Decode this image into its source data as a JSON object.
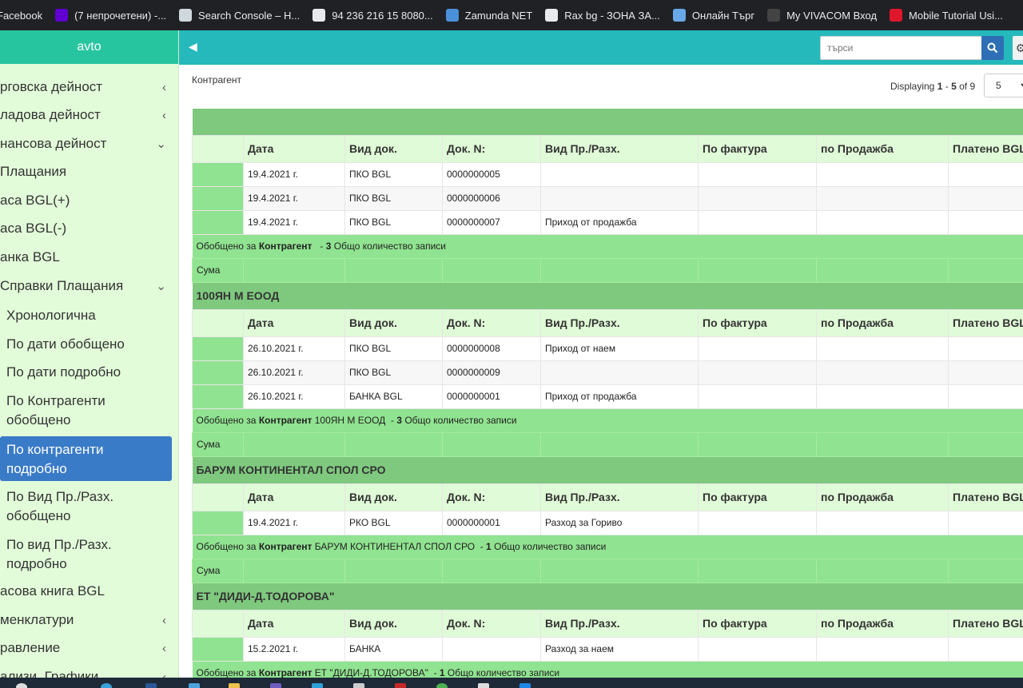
{
  "bookmarks": [
    {
      "label": "Facebook",
      "icon": "facebook-icon",
      "color": "#1877f2"
    },
    {
      "label": "(7 непрочетени) -...",
      "icon": "yahoo-mail-icon",
      "color": "#6001d2"
    },
    {
      "label": "Search Console – H...",
      "icon": "store-icon",
      "color": "#cfd8dc"
    },
    {
      "label": "94 236 216 15 8080...",
      "icon": "page-icon",
      "color": "#e8eaed"
    },
    {
      "label": "Zamunda NET",
      "icon": "globe-icon",
      "color": "#4a90d9"
    },
    {
      "label": "Rax bg - ЗОНА ЗА...",
      "icon": "page-icon",
      "color": "#e8eaed"
    },
    {
      "label": "Онлайн Търг",
      "icon": "cloud-icon",
      "color": "#6aa9e9"
    },
    {
      "label": "My VIVACOM Вход",
      "icon": "vivacom-icon",
      "color": "#444444"
    },
    {
      "label": "Mobile Tutorial Usi...",
      "icon": "e-icon",
      "color": "#e0162b"
    }
  ],
  "sidebar": {
    "title": "avto",
    "items": [
      {
        "label": "рговска дейност",
        "chevron": "‹"
      },
      {
        "label": "ладова дейност",
        "chevron": "‹"
      },
      {
        "label": "нансова дейност",
        "chevron": "⌄"
      },
      {
        "label": "Плащания",
        "chevron": ""
      },
      {
        "label": "аса BGL(+)",
        "chevron": ""
      },
      {
        "label": "аса BGL(-)",
        "chevron": ""
      },
      {
        "label": "анка BGL",
        "chevron": ""
      },
      {
        "label": "Справки Плащания",
        "chevron": "⌄"
      }
    ],
    "subitems": [
      {
        "label": "Хронологична"
      },
      {
        "label": "По дати обобщено"
      },
      {
        "label": "По дати подробно"
      },
      {
        "label": "По Контрагенти обобщено"
      },
      {
        "label": "По контрагенти подробно",
        "active": true
      },
      {
        "label": "По Вид Пр./Разх. обобщено"
      },
      {
        "label": "По вид Пр./Разх. подробно"
      }
    ],
    "bottom_items": [
      {
        "label": "асова книга BGL",
        "chevron": ""
      },
      {
        "label": "менклатури",
        "chevron": "‹"
      },
      {
        "label": "равление",
        "chevron": "‹"
      },
      {
        "label": "ализи, Графики",
        "chevron": "‹"
      }
    ]
  },
  "topbar": {
    "toggle_icon": "◀",
    "search_placeholder": "търси",
    "gear_icon": "⚙"
  },
  "content": {
    "title": "Контрагент",
    "paging": {
      "prefix": "Displaying ",
      "from": "1",
      "sep": " - ",
      "to": "5",
      "of_label": " of ",
      "total": "9"
    },
    "page_size": "5"
  },
  "columns": [
    "Дата",
    "Вид док.",
    "Док. N:",
    "Вид Пр./Разх.",
    "По фактура",
    "по Продажба",
    "Платено BGL"
  ],
  "groups": [
    {
      "name": "",
      "rows": [
        {
          "date": "19.4.2021 г.",
          "doc_type": "ПКО BGL",
          "doc_no": "0000000005",
          "kind": ""
        },
        {
          "date": "19.4.2021 г.",
          "doc_type": "ПКО BGL",
          "doc_no": "0000000006",
          "kind": ""
        },
        {
          "date": "19.4.2021 г.",
          "doc_type": "ПКО BGL",
          "doc_no": "0000000007",
          "kind": "Приход от продажба"
        }
      ],
      "summary": {
        "prefix": "Обобщено за ",
        "label": "Контрагент",
        "name": " ",
        "dash": "  - ",
        "count": "3",
        "suffix": " Общо количество записи"
      },
      "sum_label": "Сума"
    },
    {
      "name": "100ЯН М ЕООД",
      "rows": [
        {
          "date": "26.10.2021 г.",
          "doc_type": "ПКО BGL",
          "doc_no": "0000000008",
          "kind": "Приход от наем"
        },
        {
          "date": "26.10.2021 г.",
          "doc_type": "ПКО BGL",
          "doc_no": "0000000009",
          "kind": ""
        },
        {
          "date": "26.10.2021 г.",
          "doc_type": "БАНКА BGL",
          "doc_no": "0000000001",
          "kind": "Приход от продажба"
        }
      ],
      "summary": {
        "prefix": "Обобщено за ",
        "label": "Контрагент",
        "name": " 100ЯН М ЕООД",
        "dash": "  - ",
        "count": "3",
        "suffix": " Общо количество записи"
      },
      "sum_label": "Сума"
    },
    {
      "name": "БАРУМ КОНТИНЕНТАЛ СПОЛ СРО",
      "rows": [
        {
          "date": "19.4.2021 г.",
          "doc_type": "РКО BGL",
          "doc_no": "0000000001",
          "kind": "Разход за Гориво"
        }
      ],
      "summary": {
        "prefix": "Обобщено за ",
        "label": "Контрагент",
        "name": " БАРУМ КОНТИНЕНТАЛ СПОЛ СРО",
        "dash": "  - ",
        "count": "1",
        "suffix": " Общо количество записи"
      },
      "sum_label": "Сума"
    },
    {
      "name": "ЕТ \"ДИДИ-Д.ТОДОРОВА\"",
      "rows": [
        {
          "date": "15.2.2021 г.",
          "doc_type": "БАНКА",
          "doc_no": "",
          "kind": "Разход за наем"
        }
      ],
      "summary": {
        "prefix": "Обобщено за ",
        "label": "Контрагент",
        "name": " ЕТ \"ДИДИ-Д.ТОДОРОВА\"",
        "dash": "  - ",
        "count": "1",
        "suffix": " Общо количество записи"
      },
      "sum_label": ""
    }
  ],
  "colors": {
    "accent": "#25b9bc",
    "sidebar_head": "#27c59f",
    "active": "#3a7bc8",
    "group_row": "#7ec97e",
    "sum_row": "#90e390"
  }
}
